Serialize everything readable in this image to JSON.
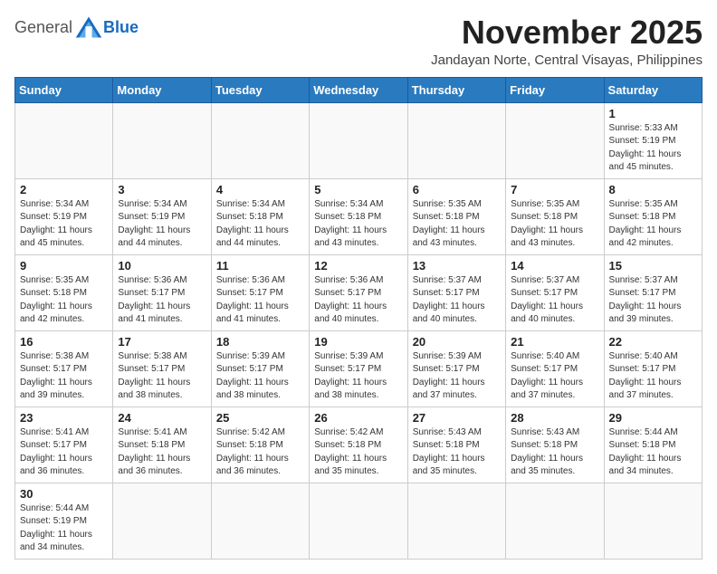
{
  "header": {
    "logo_general": "General",
    "logo_blue": "Blue",
    "month_title": "November 2025",
    "location": "Jandayan Norte, Central Visayas, Philippines"
  },
  "weekdays": [
    "Sunday",
    "Monday",
    "Tuesday",
    "Wednesday",
    "Thursday",
    "Friday",
    "Saturday"
  ],
  "weeks": [
    [
      {
        "day": "",
        "info": ""
      },
      {
        "day": "",
        "info": ""
      },
      {
        "day": "",
        "info": ""
      },
      {
        "day": "",
        "info": ""
      },
      {
        "day": "",
        "info": ""
      },
      {
        "day": "",
        "info": ""
      },
      {
        "day": "1",
        "info": "Sunrise: 5:33 AM\nSunset: 5:19 PM\nDaylight: 11 hours\nand 45 minutes."
      }
    ],
    [
      {
        "day": "2",
        "info": "Sunrise: 5:34 AM\nSunset: 5:19 PM\nDaylight: 11 hours\nand 45 minutes."
      },
      {
        "day": "3",
        "info": "Sunrise: 5:34 AM\nSunset: 5:19 PM\nDaylight: 11 hours\nand 44 minutes."
      },
      {
        "day": "4",
        "info": "Sunrise: 5:34 AM\nSunset: 5:18 PM\nDaylight: 11 hours\nand 44 minutes."
      },
      {
        "day": "5",
        "info": "Sunrise: 5:34 AM\nSunset: 5:18 PM\nDaylight: 11 hours\nand 43 minutes."
      },
      {
        "day": "6",
        "info": "Sunrise: 5:35 AM\nSunset: 5:18 PM\nDaylight: 11 hours\nand 43 minutes."
      },
      {
        "day": "7",
        "info": "Sunrise: 5:35 AM\nSunset: 5:18 PM\nDaylight: 11 hours\nand 43 minutes."
      },
      {
        "day": "8",
        "info": "Sunrise: 5:35 AM\nSunset: 5:18 PM\nDaylight: 11 hours\nand 42 minutes."
      }
    ],
    [
      {
        "day": "9",
        "info": "Sunrise: 5:35 AM\nSunset: 5:18 PM\nDaylight: 11 hours\nand 42 minutes."
      },
      {
        "day": "10",
        "info": "Sunrise: 5:36 AM\nSunset: 5:17 PM\nDaylight: 11 hours\nand 41 minutes."
      },
      {
        "day": "11",
        "info": "Sunrise: 5:36 AM\nSunset: 5:17 PM\nDaylight: 11 hours\nand 41 minutes."
      },
      {
        "day": "12",
        "info": "Sunrise: 5:36 AM\nSunset: 5:17 PM\nDaylight: 11 hours\nand 40 minutes."
      },
      {
        "day": "13",
        "info": "Sunrise: 5:37 AM\nSunset: 5:17 PM\nDaylight: 11 hours\nand 40 minutes."
      },
      {
        "day": "14",
        "info": "Sunrise: 5:37 AM\nSunset: 5:17 PM\nDaylight: 11 hours\nand 40 minutes."
      },
      {
        "day": "15",
        "info": "Sunrise: 5:37 AM\nSunset: 5:17 PM\nDaylight: 11 hours\nand 39 minutes."
      }
    ],
    [
      {
        "day": "16",
        "info": "Sunrise: 5:38 AM\nSunset: 5:17 PM\nDaylight: 11 hours\nand 39 minutes."
      },
      {
        "day": "17",
        "info": "Sunrise: 5:38 AM\nSunset: 5:17 PM\nDaylight: 11 hours\nand 38 minutes."
      },
      {
        "day": "18",
        "info": "Sunrise: 5:39 AM\nSunset: 5:17 PM\nDaylight: 11 hours\nand 38 minutes."
      },
      {
        "day": "19",
        "info": "Sunrise: 5:39 AM\nSunset: 5:17 PM\nDaylight: 11 hours\nand 38 minutes."
      },
      {
        "day": "20",
        "info": "Sunrise: 5:39 AM\nSunset: 5:17 PM\nDaylight: 11 hours\nand 37 minutes."
      },
      {
        "day": "21",
        "info": "Sunrise: 5:40 AM\nSunset: 5:17 PM\nDaylight: 11 hours\nand 37 minutes."
      },
      {
        "day": "22",
        "info": "Sunrise: 5:40 AM\nSunset: 5:17 PM\nDaylight: 11 hours\nand 37 minutes."
      }
    ],
    [
      {
        "day": "23",
        "info": "Sunrise: 5:41 AM\nSunset: 5:17 PM\nDaylight: 11 hours\nand 36 minutes."
      },
      {
        "day": "24",
        "info": "Sunrise: 5:41 AM\nSunset: 5:18 PM\nDaylight: 11 hours\nand 36 minutes."
      },
      {
        "day": "25",
        "info": "Sunrise: 5:42 AM\nSunset: 5:18 PM\nDaylight: 11 hours\nand 36 minutes."
      },
      {
        "day": "26",
        "info": "Sunrise: 5:42 AM\nSunset: 5:18 PM\nDaylight: 11 hours\nand 35 minutes."
      },
      {
        "day": "27",
        "info": "Sunrise: 5:43 AM\nSunset: 5:18 PM\nDaylight: 11 hours\nand 35 minutes."
      },
      {
        "day": "28",
        "info": "Sunrise: 5:43 AM\nSunset: 5:18 PM\nDaylight: 11 hours\nand 35 minutes."
      },
      {
        "day": "29",
        "info": "Sunrise: 5:44 AM\nSunset: 5:18 PM\nDaylight: 11 hours\nand 34 minutes."
      }
    ],
    [
      {
        "day": "30",
        "info": "Sunrise: 5:44 AM\nSunset: 5:19 PM\nDaylight: 11 hours\nand 34 minutes."
      },
      {
        "day": "",
        "info": ""
      },
      {
        "day": "",
        "info": ""
      },
      {
        "day": "",
        "info": ""
      },
      {
        "day": "",
        "info": ""
      },
      {
        "day": "",
        "info": ""
      },
      {
        "day": "",
        "info": ""
      }
    ]
  ]
}
